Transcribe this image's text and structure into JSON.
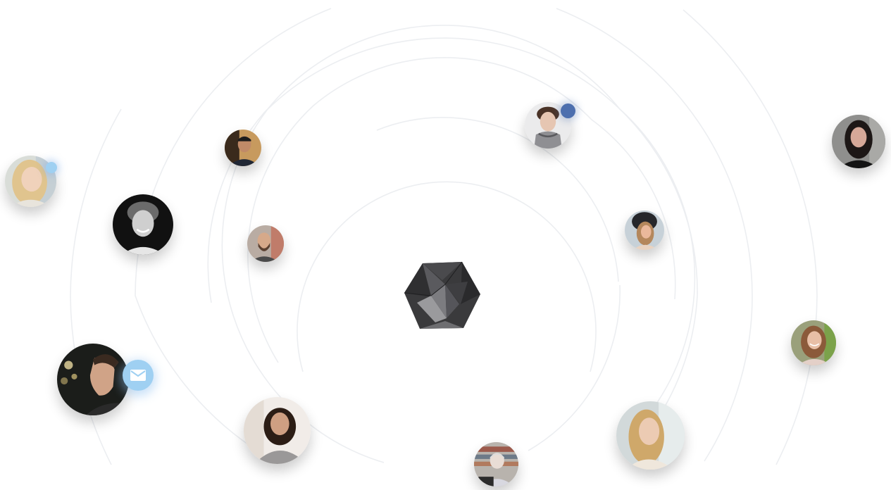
{
  "scene": {
    "logo_icon": "icosahedron-logo-icon",
    "badge_icon": "mail-icon",
    "colors": {
      "ring": "#eceef1",
      "dot_light": "#9fd0f2",
      "dot_dark": "#4d6fae",
      "logo_dark": "#3a3a3c",
      "logo_light": "#8a8a8d"
    }
  },
  "avatars": [
    {
      "name": "avatar-blonde-woman-left"
    },
    {
      "name": "avatar-curly-man-smiling"
    },
    {
      "name": "avatar-man-with-hands"
    },
    {
      "name": "avatar-bearded-man"
    },
    {
      "name": "avatar-man-profile-night"
    },
    {
      "name": "avatar-curly-woman-white-room"
    },
    {
      "name": "avatar-older-woman-laptop"
    },
    {
      "name": "avatar-blonde-woman-bottom"
    },
    {
      "name": "avatar-man-with-scarf"
    },
    {
      "name": "avatar-woman-beanie"
    },
    {
      "name": "avatar-dark-haired-woman"
    },
    {
      "name": "avatar-smiling-woman-right"
    }
  ]
}
